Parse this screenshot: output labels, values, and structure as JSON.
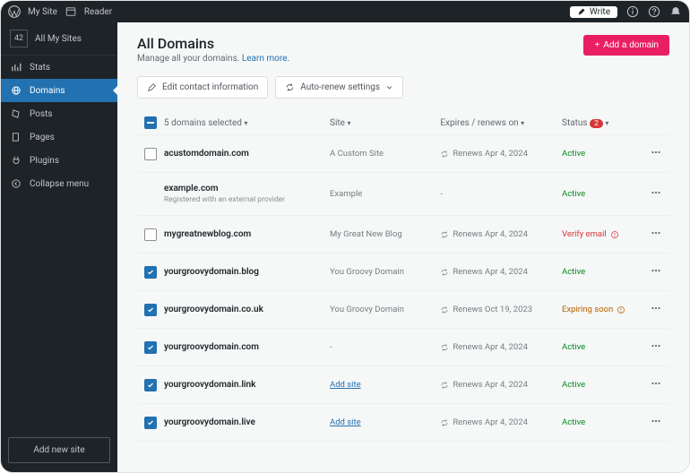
{
  "topbar": {
    "mysite": "My Site",
    "reader": "Reader",
    "write": "Write"
  },
  "sidebar": {
    "allsites": "All My Sites",
    "sitecount": "42",
    "items": [
      {
        "id": "stats",
        "label": "Stats"
      },
      {
        "id": "domains",
        "label": "Domains"
      },
      {
        "id": "posts",
        "label": "Posts"
      },
      {
        "id": "pages",
        "label": "Pages"
      },
      {
        "id": "plugins",
        "label": "Plugins"
      },
      {
        "id": "collapse",
        "label": "Collapse menu"
      }
    ],
    "addnewsite": "Add new site"
  },
  "header": {
    "title": "All Domains",
    "subtitle_prefix": "Manage all your domains. ",
    "subtitle_link": "Learn more.",
    "add_domain": "Add a domain"
  },
  "toolbar": {
    "edit_contact": "Edit contact information",
    "autorenew": "Auto-renew settings"
  },
  "table": {
    "selected_label": "5 domains selected",
    "col_site": "Site",
    "col_expires": "Expires / renews on",
    "col_status": "Status",
    "status_badge": "2",
    "rows": [
      {
        "checked": false,
        "domain": "acustomdomain.com",
        "sub": "",
        "site": "A Custom Site",
        "site_link": false,
        "renews": "Renews Apr 4, 2024",
        "status": "Active",
        "status_type": "active",
        "status_icon": ""
      },
      {
        "checked": "none",
        "domain": "example.com",
        "sub": "Registered with an external provider",
        "site": "Example",
        "site_link": false,
        "renews": "-",
        "status": "Active",
        "status_type": "active",
        "status_icon": ""
      },
      {
        "checked": false,
        "domain": "mygreatnewblog.com",
        "sub": "",
        "site": "My Great New Blog",
        "site_link": false,
        "renews": "Renews Apr 4, 2024",
        "status": "Verify email",
        "status_type": "warn",
        "status_icon": "alert"
      },
      {
        "checked": true,
        "domain": "yourgroovydomain.blog",
        "sub": "",
        "site": "You Groovy Domain",
        "site_link": false,
        "renews": "Renews Apr 4, 2024",
        "status": "Active",
        "status_type": "active",
        "status_icon": ""
      },
      {
        "checked": true,
        "domain": "yourgroovydomain.co.uk",
        "sub": "",
        "site": "You Groovy Domain",
        "site_link": false,
        "renews": "Renews Oct 19, 2023",
        "status": "Expiring soon",
        "status_type": "expiring",
        "status_icon": "alert"
      },
      {
        "checked": true,
        "domain": "yourgroovydomain.com",
        "sub": "",
        "site": "-",
        "site_link": false,
        "renews": "Renews Apr 4, 2024",
        "status": "Active",
        "status_type": "active",
        "status_icon": ""
      },
      {
        "checked": true,
        "domain": "yourgroovydomain.link",
        "sub": "",
        "site": "Add site",
        "site_link": true,
        "renews": "Renews Apr 4, 2024",
        "status": "Active",
        "status_type": "active",
        "status_icon": ""
      },
      {
        "checked": true,
        "domain": "yourgroovydomain.live",
        "sub": "",
        "site": "Add site",
        "site_link": true,
        "renews": "Renews Apr 4, 2024",
        "status": "Active",
        "status_type": "active",
        "status_icon": ""
      }
    ]
  }
}
